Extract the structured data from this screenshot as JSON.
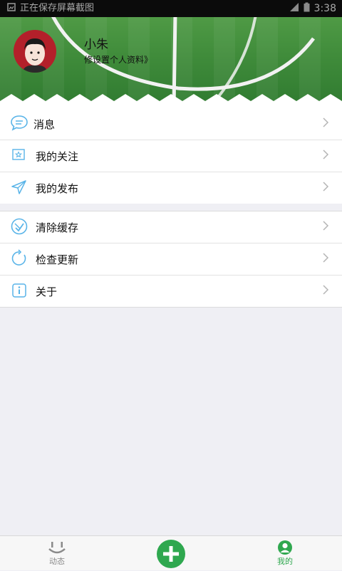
{
  "status_bar": {
    "notification": "正在保存屏幕截图",
    "time": "3:38"
  },
  "profile": {
    "name": "小朱",
    "edit_link": "修设置个人资料》"
  },
  "menu_group_1": [
    {
      "label": "消息",
      "icon": "chat-bubble-icon"
    },
    {
      "label": "我的关注",
      "icon": "home-star-icon"
    },
    {
      "label": "我的发布",
      "icon": "send-icon"
    }
  ],
  "menu_group_2": [
    {
      "label": "清除缓存",
      "icon": "clear-cache-icon"
    },
    {
      "label": "检查更新",
      "icon": "refresh-icon"
    },
    {
      "label": "关于",
      "icon": "info-icon"
    }
  ],
  "bottom_nav": {
    "moments": "动态",
    "mine": "我的"
  },
  "colors": {
    "accent_green": "#2fa84f",
    "icon_blue": "#59b4e8",
    "avatar_red": "#b3202a",
    "nav_inactive": "#8a8a8a"
  }
}
